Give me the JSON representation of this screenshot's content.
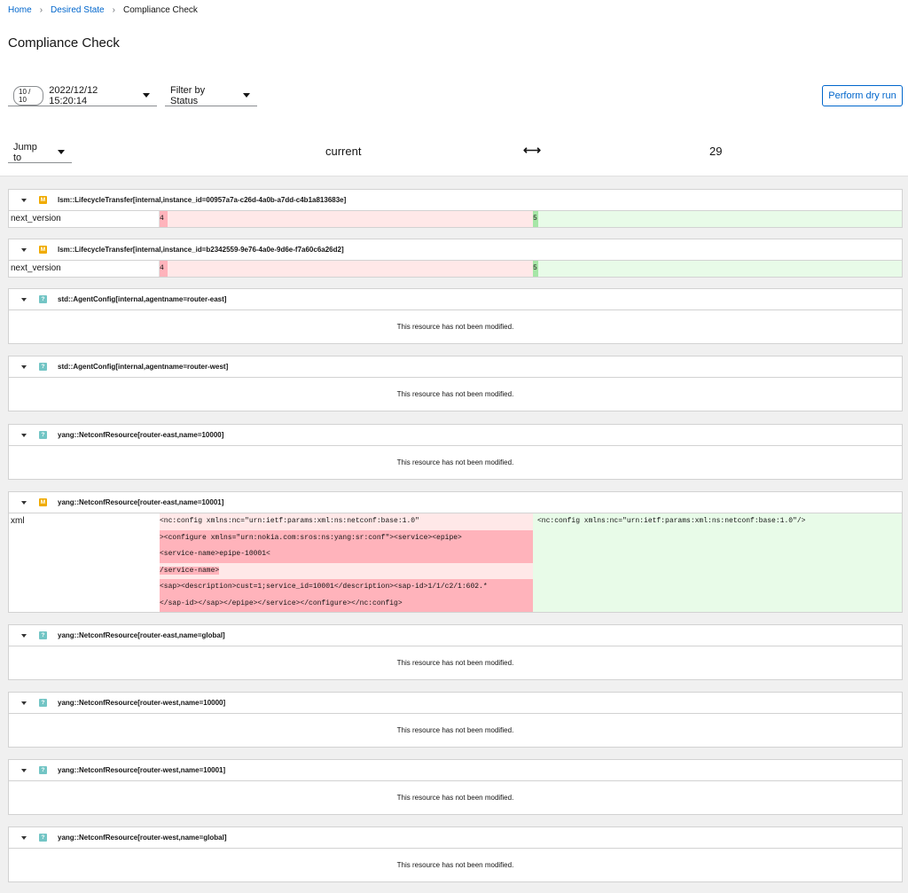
{
  "breadcrumb": {
    "home": "Home",
    "desired_state": "Desired State",
    "current": "Compliance Check"
  },
  "page_title": "Compliance Check",
  "toolbar": {
    "version_badge": "10 / 10",
    "version_date": "2022/12/12 15:20:14",
    "filter_label": "Filter by Status",
    "dry_run_label": "Perform dry run"
  },
  "compare": {
    "jump_label": "Jump to",
    "from": "current",
    "arrow": "⟷",
    "to": "29"
  },
  "not_modified_text": "This resource has not been modified.",
  "resources": [
    {
      "status": "M",
      "title": "lsm::LifecycleTransfer[internal,instance_id=00957a7a-c26d-4a0b-a7dd-c4b1a813683e]",
      "key": "next_version",
      "old": "4",
      "new": "5"
    },
    {
      "status": "M",
      "title": "lsm::LifecycleTransfer[internal,instance_id=b2342559-9e76-4a0e-9d6e-f7a60c6a26d2]",
      "key": "next_version",
      "old": "4",
      "new": "5"
    },
    {
      "status": "?",
      "title": "std::AgentConfig[internal,agentname=router-east]"
    },
    {
      "status": "?",
      "title": "std::AgentConfig[internal,agentname=router-west]"
    },
    {
      "status": "?",
      "title": "yang::NetconfResource[router-east,name=10000]"
    },
    {
      "status": "M",
      "title": "yang::NetconfResource[router-east,name=10001]",
      "key": "xml",
      "old_lines": [
        "<nc:config xmlns:nc=\"urn:ietf:params:xml:ns:netconf:base:1.0\"",
        "><configure xmlns=\"urn:nokia.com:sros:ns:yang:sr:conf\"><service><epipe>",
        "<service-name>epipe-10001<",
        "/service-name>",
        "<sap><description>cust=1;service_id=10001</description><sap-id>1/1/c2/1:602.*",
        "</sap-id></sap></epipe></service></configure></nc:config>"
      ],
      "new": "<nc:config xmlns:nc=\"urn:ietf:params:xml:ns:netconf:base:1.0\"/>"
    },
    {
      "status": "?",
      "title": "yang::NetconfResource[router-east,name=global]"
    },
    {
      "status": "?",
      "title": "yang::NetconfResource[router-west,name=10000]"
    },
    {
      "status": "?",
      "title": "yang::NetconfResource[router-west,name=10001]"
    },
    {
      "status": "?",
      "title": "yang::NetconfResource[router-west,name=global]"
    }
  ],
  "colors": {
    "link": "#0066cc",
    "modified": "#f0ab00",
    "unchanged": "#73c5c5",
    "removed_bg": "#ffe8e8",
    "removed_hl": "#ffb3bb",
    "added_bg": "#e8fbe8",
    "added_hl": "#a7e6a7"
  }
}
